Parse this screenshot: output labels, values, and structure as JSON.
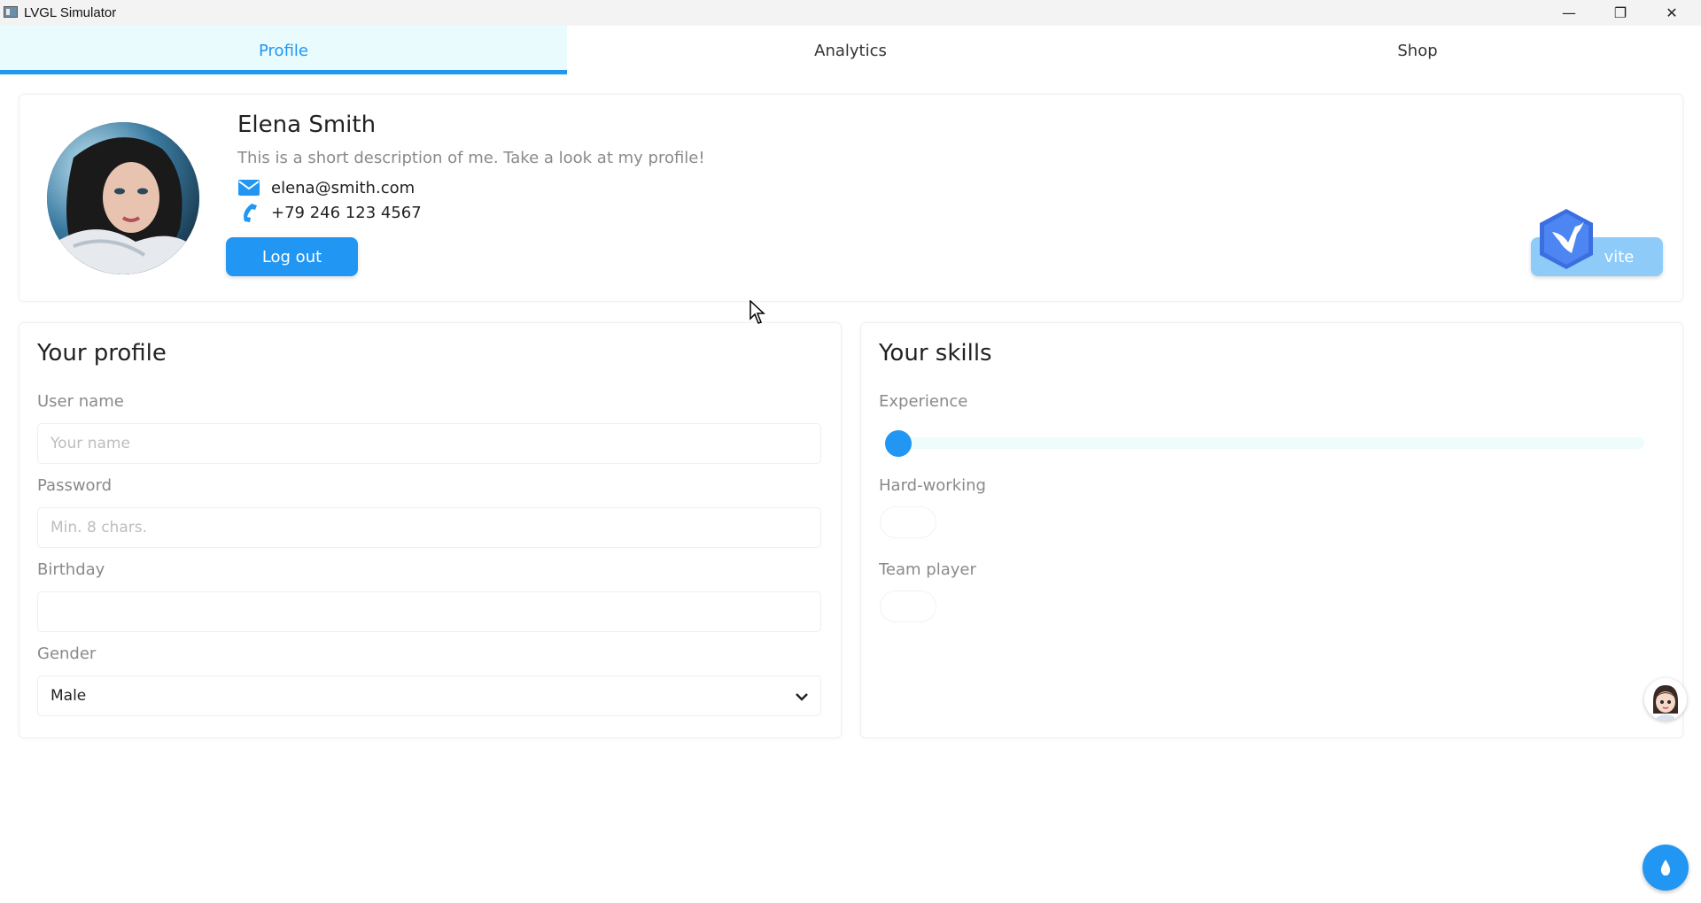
{
  "window": {
    "title": "LVGL Simulator",
    "minimize": "—",
    "maximize": "❐",
    "close": "✕"
  },
  "tabs": [
    {
      "label": "Profile",
      "active": true
    },
    {
      "label": "Analytics",
      "active": false
    },
    {
      "label": "Shop",
      "active": false
    }
  ],
  "profile": {
    "name": "Elena Smith",
    "description": "This is a short description of me. Take a look at my profile!",
    "email": "elena@smith.com",
    "phone": "+79 246 123 4567",
    "logout_label": "Log out",
    "invite_label": "vite"
  },
  "your_profile": {
    "title": "Your profile",
    "username_label": "User name",
    "username_placeholder": "Your name",
    "password_label": "Password",
    "password_placeholder": "Min. 8 chars.",
    "birthday_label": "Birthday",
    "birthday_value": "",
    "gender_label": "Gender",
    "gender_value": "Male"
  },
  "your_skills": {
    "title": "Your skills",
    "experience_label": "Experience",
    "experience_value": 0,
    "hardworking_label": "Hard-working",
    "hardworking_on": false,
    "teamplayer_label": "Team player",
    "teamplayer_on": false
  },
  "colors": {
    "accent": "#2196f3",
    "tab_active_bg": "#e9fbfd",
    "invite_bg": "#8fcbf9"
  },
  "icons": [
    "envelope-icon",
    "phone-icon",
    "chevron-down-icon",
    "bird-logo-icon",
    "water-drop-icon",
    "mouse-cursor-icon"
  ]
}
